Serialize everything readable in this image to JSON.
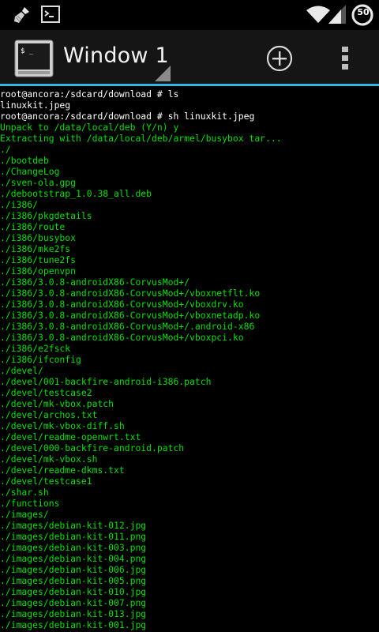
{
  "status_bar": {
    "battery_level": "50",
    "icons": [
      "broom-icon",
      "terminal-notification-icon",
      "wifi-icon",
      "signal-icon",
      "battery-icon"
    ]
  },
  "app_bar": {
    "title": "Window 1",
    "icons": [
      "terminal-app-icon",
      "window-dropdown-icon",
      "add-window-icon",
      "overflow-menu-icon"
    ],
    "accent_color": "#33b5e5"
  },
  "terminal": {
    "white": "#ffffff",
    "green": "#00e000",
    "lines": [
      {
        "text": "root@ancora:/sdcard/download # ls",
        "color": "white"
      },
      {
        "text": "linuxkit.jpeg",
        "color": "white"
      },
      {
        "text": "root@ancora:/sdcard/download # sh linuxkit.jpeg",
        "color": "white"
      },
      {
        "text": "Unpack to /data/local/deb (Y/n) y",
        "color": "green"
      },
      {
        "text": "Extracting with /data/local/deb/armel/busybox tar...",
        "color": "green"
      },
      {
        "text": "./",
        "color": "green"
      },
      {
        "text": "./bootdeb",
        "color": "green"
      },
      {
        "text": "./ChangeLog",
        "color": "green"
      },
      {
        "text": "./sven-ola.gpg",
        "color": "green"
      },
      {
        "text": "./debootstrap_1.0.38_all.deb",
        "color": "green"
      },
      {
        "text": "./i386/",
        "color": "green"
      },
      {
        "text": "./i386/pkgdetails",
        "color": "green"
      },
      {
        "text": "./i386/route",
        "color": "green"
      },
      {
        "text": "./i386/busybox",
        "color": "green"
      },
      {
        "text": "./i386/mke2fs",
        "color": "green"
      },
      {
        "text": "./i386/tune2fs",
        "color": "green"
      },
      {
        "text": "./i386/openvpn",
        "color": "green"
      },
      {
        "text": "./i386/3.0.8-androidX86-CorvusMod+/",
        "color": "green"
      },
      {
        "text": "./i386/3.0.8-androidX86-CorvusMod+/vboxnetflt.ko",
        "color": "green"
      },
      {
        "text": "./i386/3.0.8-androidX86-CorvusMod+/vboxdrv.ko",
        "color": "green"
      },
      {
        "text": "./i386/3.0.8-androidX86-CorvusMod+/vboxnetadp.ko",
        "color": "green"
      },
      {
        "text": "./i386/3.0.8-androidX86-CorvusMod+/.android-x86",
        "color": "green"
      },
      {
        "text": "./i386/3.0.8-androidX86-CorvusMod+/vboxpci.ko",
        "color": "green"
      },
      {
        "text": "./i386/e2fsck",
        "color": "green"
      },
      {
        "text": "./i386/ifconfig",
        "color": "green"
      },
      {
        "text": "./devel/",
        "color": "green"
      },
      {
        "text": "./devel/001-backfire-android-i386.patch",
        "color": "green"
      },
      {
        "text": "./devel/testcase2",
        "color": "green"
      },
      {
        "text": "./devel/mk-vbox.patch",
        "color": "green"
      },
      {
        "text": "./devel/archos.txt",
        "color": "green"
      },
      {
        "text": "./devel/mk-vbox-diff.sh",
        "color": "green"
      },
      {
        "text": "./devel/readme-openwrt.txt",
        "color": "green"
      },
      {
        "text": "./devel/000-backfire-android.patch",
        "color": "green"
      },
      {
        "text": "./devel/mk-vbox.sh",
        "color": "green"
      },
      {
        "text": "./devel/readme-dkms.txt",
        "color": "green"
      },
      {
        "text": "./devel/testcase1",
        "color": "green"
      },
      {
        "text": "./shar.sh",
        "color": "green"
      },
      {
        "text": "./functions",
        "color": "green"
      },
      {
        "text": "./images/",
        "color": "green"
      },
      {
        "text": "./images/debian-kit-012.jpg",
        "color": "green"
      },
      {
        "text": "./images/debian-kit-011.png",
        "color": "green"
      },
      {
        "text": "./images/debian-kit-003.png",
        "color": "green"
      },
      {
        "text": "./images/debian-kit-004.png",
        "color": "green"
      },
      {
        "text": "./images/debian-kit-006.jpg",
        "color": "green"
      },
      {
        "text": "./images/debian-kit-005.png",
        "color": "green"
      },
      {
        "text": "./images/debian-kit-010.jpg",
        "color": "green"
      },
      {
        "text": "./images/debian-kit-007.png",
        "color": "green"
      },
      {
        "text": "./images/debian-kit-013.jpg",
        "color": "green"
      },
      {
        "text": "./images/debian-kit-001.jpg",
        "color": "green"
      }
    ]
  }
}
